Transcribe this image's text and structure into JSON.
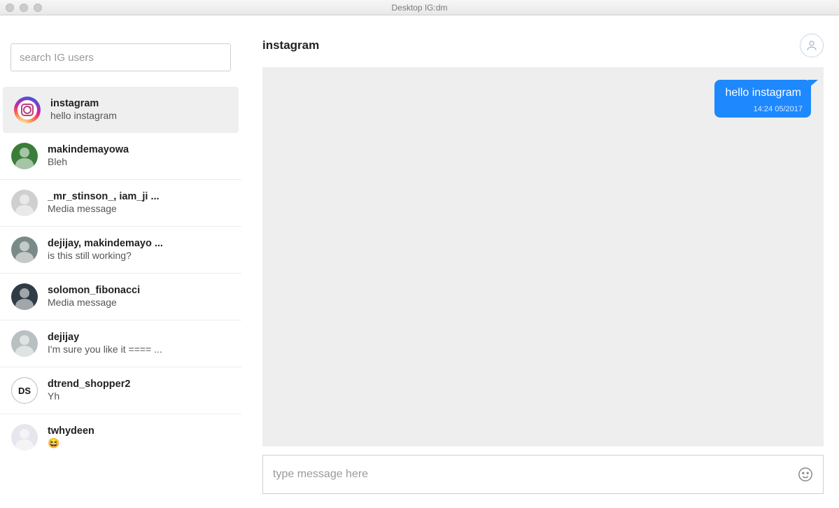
{
  "window": {
    "title": "Desktop IG:dm"
  },
  "sidebar": {
    "search_placeholder": "search IG users",
    "conversations": [
      {
        "name": "instagram",
        "preview": "hello instagram",
        "avatar_bg": "ig",
        "active": true
      },
      {
        "name": "makindemayowa",
        "preview": "Bleh",
        "avatar_bg": "#3a7d3a"
      },
      {
        "name": "_mr_stinson_, iam_ji ...",
        "preview": "Media message",
        "avatar_bg": "#cfcfcf"
      },
      {
        "name": "dejijay, makindemayo ...",
        "preview": "is this still working?",
        "avatar_bg": "#7a8a88"
      },
      {
        "name": "solomon_fibonacci",
        "preview": "Media message",
        "avatar_bg": "#2f3b45"
      },
      {
        "name": "dejijay",
        "preview": "I'm sure you like it ==== ...",
        "avatar_bg": "#b8c0c2"
      },
      {
        "name": "dtrend_shopper2",
        "preview": "Yh",
        "avatar_bg": "#ffffff",
        "avatar_text": "DS",
        "avatar_border": true
      },
      {
        "name": "twhydeen",
        "preview": "😆",
        "avatar_bg": "#e6e6ee"
      }
    ]
  },
  "chat": {
    "title": "instagram",
    "messages": [
      {
        "text": "hello instagram",
        "time": "14:24 05/2017",
        "outgoing": true
      }
    ],
    "composer_placeholder": "type message here"
  },
  "colors": {
    "accent": "#1e88ff"
  }
}
